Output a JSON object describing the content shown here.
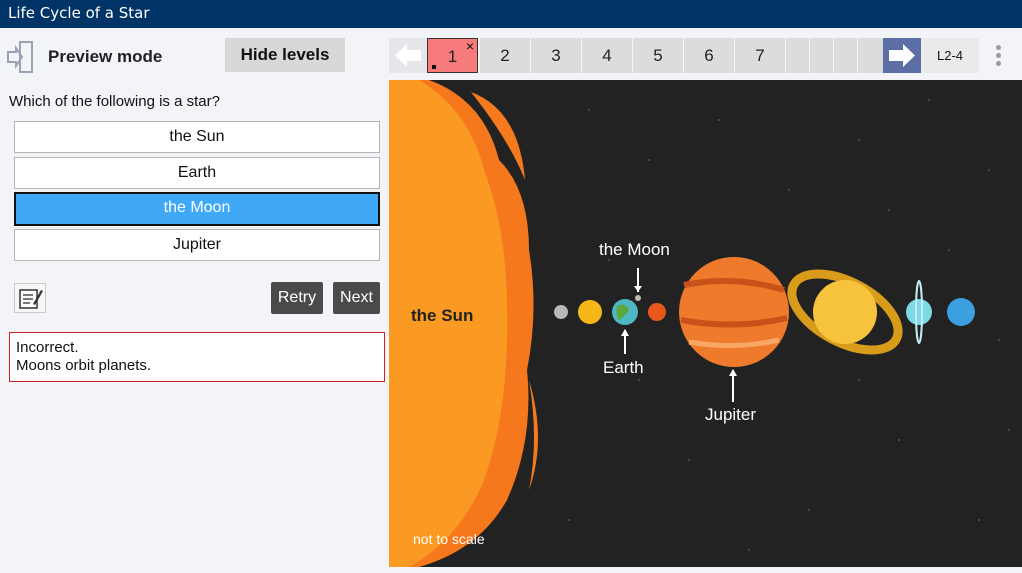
{
  "app": {
    "title": "Life Cycle of a Star"
  },
  "header": {
    "mode_label": "Preview mode",
    "hide_levels_label": "Hide levels"
  },
  "question": {
    "text": "Which of the following is a star?",
    "options": [
      {
        "label": "the Sun",
        "selected": false
      },
      {
        "label": "Earth",
        "selected": false
      },
      {
        "label": "the Moon",
        "selected": true
      },
      {
        "label": "Jupiter",
        "selected": false
      }
    ]
  },
  "actions": {
    "retry_label": "Retry",
    "next_label": "Next"
  },
  "feedback": {
    "line1": "Incorrect.",
    "line2": "Moons orbit planets.",
    "border_color": "#cc2222"
  },
  "levels": {
    "items": [
      "1",
      "2",
      "3",
      "4",
      "5",
      "6",
      "7"
    ],
    "current": "1",
    "current_marker": "×",
    "code": "L2-4"
  },
  "image": {
    "labels": {
      "sun": "the Sun",
      "moon": "the Moon",
      "earth": "Earth",
      "jupiter": "Jupiter",
      "scale_note": "not to scale"
    }
  },
  "colors": {
    "titlebar": "#003366",
    "selected_option": "#3fa9f5",
    "current_level": "#f77b7b",
    "stage_bg": "#222222"
  }
}
